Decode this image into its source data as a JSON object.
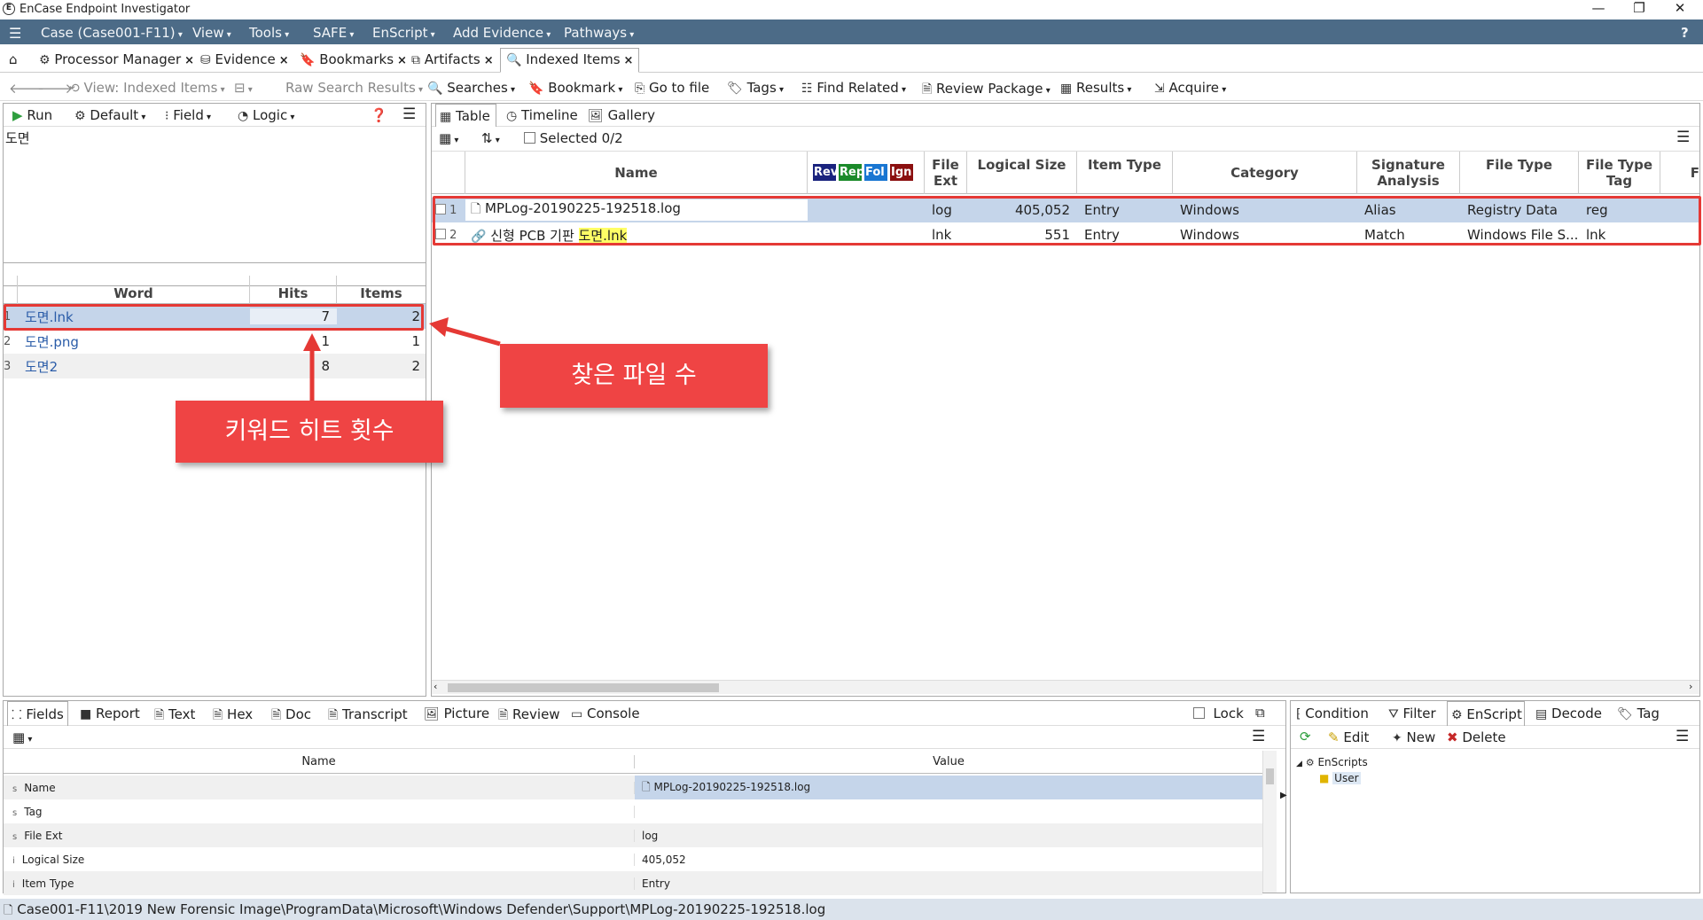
{
  "window": {
    "title": "EnCase Endpoint Investigator",
    "controls": [
      "—",
      "❐",
      "✕"
    ]
  },
  "menubar": {
    "items": [
      "Case (Case001-F11)",
      "View",
      "Tools",
      "SAFE",
      "EnScript",
      "Add Evidence",
      "Pathways"
    ]
  },
  "tabs": [
    {
      "label": "Processor Manager"
    },
    {
      "label": "Evidence"
    },
    {
      "label": "Bookmarks"
    },
    {
      "label": "Artifacts"
    },
    {
      "label": "Indexed Items"
    }
  ],
  "toolbar": {
    "view": "View: Indexed Items",
    "raw_search": "Raw Search Results",
    "searches": "Searches",
    "bookmark": "Bookmark",
    "goto": "Go to file",
    "tags": "Tags",
    "find_related": "Find Related",
    "review_package": "Review Package",
    "results": "Results",
    "acquire": "Acquire"
  },
  "left": {
    "run": "Run",
    "default": "Default",
    "field": "Field",
    "logic": "Logic",
    "query": "도면",
    "columns": [
      "Word",
      "Hits",
      "Items"
    ],
    "rows": [
      {
        "n": "1",
        "word": "도면.lnk",
        "hits": "7",
        "items": "2"
      },
      {
        "n": "2",
        "word": "도면.png",
        "hits": "1",
        "items": "1"
      },
      {
        "n": "3",
        "word": "도면2",
        "hits": "8",
        "items": "2"
      }
    ]
  },
  "right": {
    "view_tabs": [
      "Table",
      "Timeline",
      "Gallery"
    ],
    "selected": "Selected 0/2",
    "tag_chips": [
      {
        "label": "Rev",
        "color": "#1a237e"
      },
      {
        "label": "Rep",
        "color": "#1b8a2a"
      },
      {
        "label": "Fol",
        "color": "#1976d2"
      },
      {
        "label": "Ign",
        "color": "#8b1010"
      }
    ],
    "columns": {
      "name": "Name",
      "file_ext": "File Ext",
      "logical_size": "Logical Size",
      "item_type": "Item Type",
      "category": "Category",
      "signature": "Signature Analysis",
      "file_type": "File Type",
      "file_type_tag": "File Type Tag",
      "extra": "F"
    },
    "rows": [
      {
        "n": "1",
        "name": "MPLog-20190225-192518.log",
        "name_hl": "",
        "ext": "log",
        "size": "405,052",
        "type": "Entry",
        "category": "Windows",
        "sig": "Alias",
        "ftype": "Registry Data",
        "ftag": "reg"
      },
      {
        "n": "2",
        "name": "신형 PCB 기판 ",
        "name_hl": "도면.lnk",
        "ext": "lnk",
        "size": "551",
        "type": "Entry",
        "category": "Windows",
        "sig": "Match",
        "ftype": "Windows File S...",
        "ftag": "lnk"
      }
    ]
  },
  "callouts": {
    "files_found": "찾은 파일 수",
    "keyword_hits": "키워드 히트 횟수"
  },
  "bottom": {
    "tabs": [
      "Fields",
      "Report",
      "Text",
      "Hex",
      "Doc",
      "Transcript",
      "Picture",
      "Review",
      "Console"
    ],
    "lock": "Lock",
    "columns": [
      "Name",
      "Value"
    ],
    "fields": [
      {
        "type": "s",
        "name": "Name",
        "value": "MPLog-20190225-192518.log"
      },
      {
        "type": "s",
        "name": "Tag",
        "value": ""
      },
      {
        "type": "s",
        "name": "File Ext",
        "value": "log"
      },
      {
        "type": "i",
        "name": "Logical Size",
        "value": "405,052"
      },
      {
        "type": "i",
        "name": "Item Type",
        "value": "Entry"
      }
    ]
  },
  "bottom_right": {
    "tabs": [
      "Condition",
      "Filter",
      "EnScript",
      "Decode",
      "Tag"
    ],
    "actions": [
      "Edit",
      "New",
      "Delete"
    ],
    "tree_root": "EnScripts",
    "tree_child": "User"
  },
  "status": {
    "path": "Case001-F11\\2019 New Forensic Image\\ProgramData\\Microsoft\\Windows Defender\\Support\\MPLog-20190225-192518.log"
  },
  "colors": {
    "menubar": "#4c6b87",
    "selection": "#c5d5ea",
    "annotation_red": "#e53935"
  }
}
